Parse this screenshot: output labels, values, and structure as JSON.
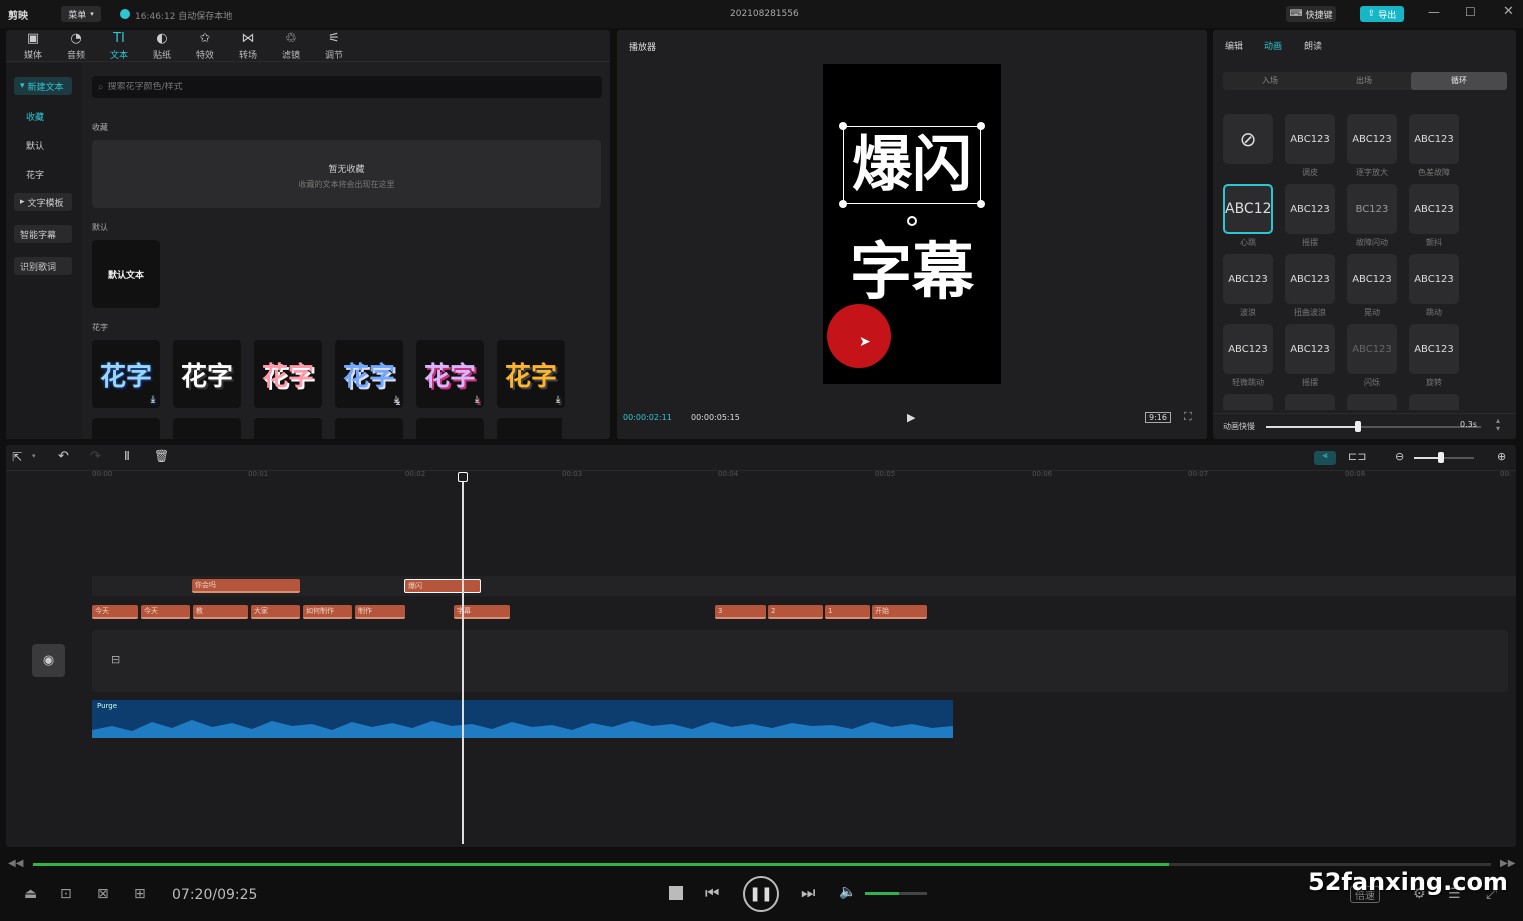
{
  "app": {
    "logo": "剪映",
    "menu": "菜单",
    "autosave": "16:46:12 自动保存本地",
    "project": "202108281556",
    "shortcut": "快捷键",
    "export": "导出"
  },
  "tabs": [
    {
      "label": "媒体",
      "icon": "media-icon",
      "glyph": "▣"
    },
    {
      "label": "音频",
      "icon": "audio-icon",
      "glyph": "◔"
    },
    {
      "label": "文本",
      "icon": "text-icon",
      "glyph": "TI"
    },
    {
      "label": "贴纸",
      "icon": "sticker-icon",
      "glyph": "◐"
    },
    {
      "label": "特效",
      "icon": "effects-icon",
      "glyph": "✩"
    },
    {
      "label": "转场",
      "icon": "transition-icon",
      "glyph": "⋈"
    },
    {
      "label": "滤镜",
      "icon": "filter-icon",
      "glyph": "♲"
    },
    {
      "label": "调节",
      "icon": "adjust-icon",
      "glyph": "⚟"
    }
  ],
  "sidebar": {
    "new_text": "新建文本",
    "fav": "收藏",
    "default": "默认",
    "flower": "花字",
    "template": "文字模板",
    "smart": "智能字幕",
    "lyrics": "识别歌词"
  },
  "search": {
    "placeholder": "搜索花字颜色/样式"
  },
  "library": {
    "fav_title": "收藏",
    "fav_empty": "暂无收藏",
    "fav_hint": "收藏的文本将会出现在这里",
    "default_title": "默认",
    "default_text": "默认文本",
    "flower_title": "花字",
    "flower_text": "花字"
  },
  "player": {
    "title": "播放器",
    "text1": "爆闪",
    "text2": "字幕",
    "time_current": "00:00:02:11",
    "time_total": "00:00:05:15",
    "ratio": "9:16"
  },
  "right": {
    "tabs": [
      "编辑",
      "动画",
      "朗读"
    ],
    "subtabs": [
      "入场",
      "出场",
      "循环"
    ],
    "anims": [
      {
        "t": "⃠",
        "l": ""
      },
      {
        "t": "ABC123",
        "l": "调皮"
      },
      {
        "t": "ABC123",
        "l": "逐字放大"
      },
      {
        "t": "ABC123",
        "l": "色差故障"
      },
      {
        "t": "ABC12:",
        "l": "心跳"
      },
      {
        "t": "ABC123",
        "l": "摇摆"
      },
      {
        "t": "BC123",
        "l": "故障闪动"
      },
      {
        "t": "ABC123",
        "l": "颤抖"
      },
      {
        "t": "ABC123",
        "l": "波浪"
      },
      {
        "t": "ABC123",
        "l": "扭曲波浪"
      },
      {
        "t": "ABC123",
        "l": "晃动"
      },
      {
        "t": "ABC123",
        "l": "跳动"
      },
      {
        "t": "ABC123",
        "l": "轻微跳动"
      },
      {
        "t": "ABC123",
        "l": "摇摆"
      },
      {
        "t": "ABC123",
        "l": "闪烁"
      },
      {
        "t": "ABC123",
        "l": "旋转"
      }
    ],
    "speed_label": "动画快慢",
    "speed_value": "0.3s"
  },
  "timeline": {
    "ticks": [
      "00:00",
      "00:01",
      "00:02",
      "00:03",
      "00:04",
      "00:05",
      "00:06",
      "00:07",
      "00:08",
      "00:"
    ],
    "track1": [
      "你会吗",
      "爆闪"
    ],
    "track2": [
      "今天",
      "今天",
      "教",
      "大家",
      "如何制作",
      "制作",
      "字幕",
      "3",
      "2",
      "1",
      "开始"
    ],
    "audio": "Purge"
  },
  "media_player": {
    "time": "07:20/09:25",
    "speed": "倍速"
  },
  "watermark": "52fanxing.com"
}
